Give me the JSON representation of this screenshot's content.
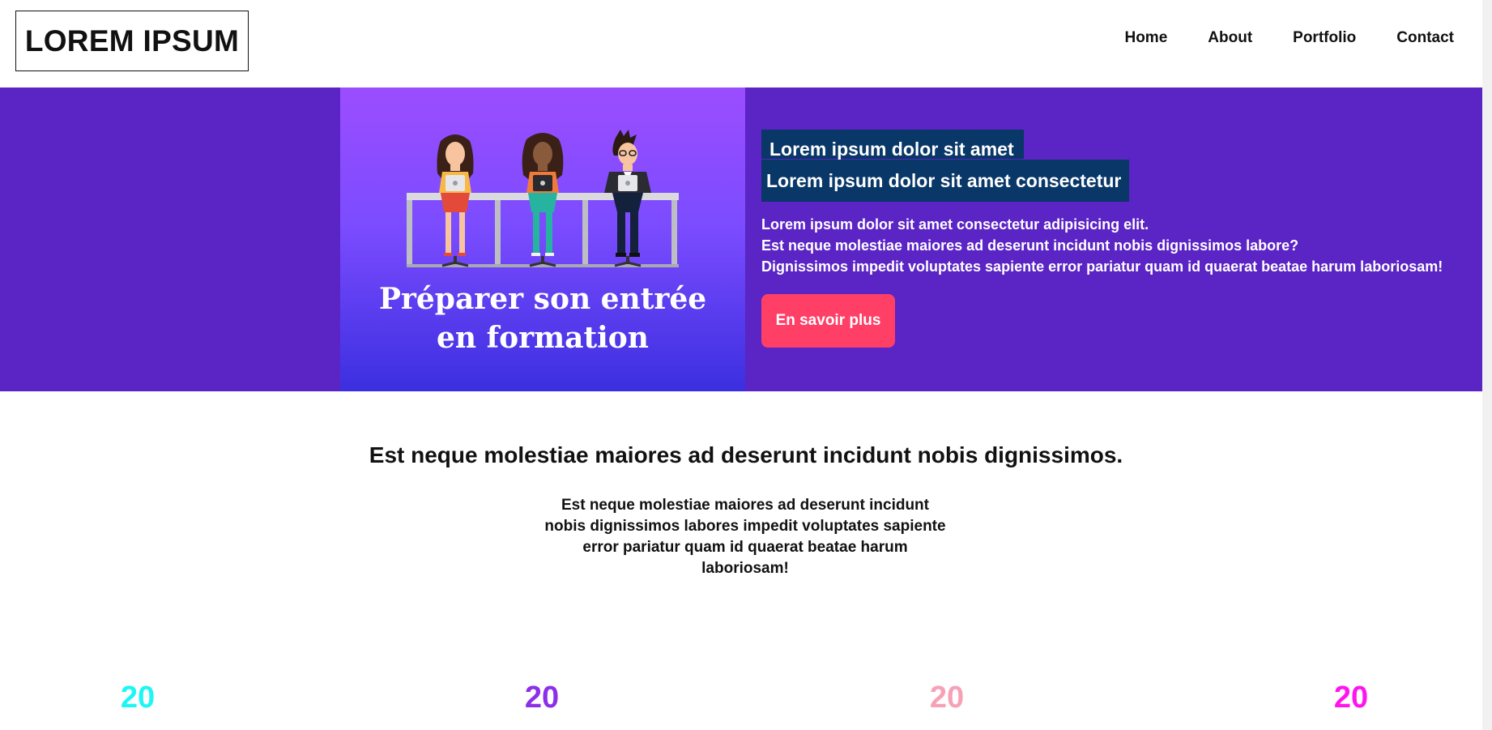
{
  "header": {
    "logo": "LOREM IPSUM",
    "nav": [
      "Home",
      "About",
      "Portfolio",
      "Contact"
    ]
  },
  "hero": {
    "image_caption_line1": "Préparer son entrée",
    "image_caption_line2": "en formation",
    "highlight_line1": "Lorem ipsum dolor sit amet",
    "highlight_line2": "Lorem ipsum dolor sit amet consectetur",
    "paragraph": [
      "Lorem ipsum dolor sit amet consectetur adipisicing elit.",
      "Est neque molestiae maiores ad deserunt incidunt nobis dignissimos labore?",
      "Dignissimos impedit voluptates sapiente error pariatur quam id quaerat beatae harum laboriosam!"
    ],
    "cta_label": "En savoir plus"
  },
  "section": {
    "title": "Est neque molestiae maiores ad deserunt incidunt nobis dignissimos.",
    "text_lines": [
      "Est neque molestiae maiores ad deserunt incidunt",
      "nobis dignissimos labores impedit voluptates sapiente",
      "error pariatur quam id quaerat beatae harum",
      "laboriosam!"
    ]
  },
  "stats": [
    {
      "value": "20",
      "color": "#1ef6f6"
    },
    {
      "value": "20",
      "color": "#8d2ee8"
    },
    {
      "value": "20",
      "color": "#f7a1b5"
    },
    {
      "value": "20",
      "color": "#ff14f0"
    }
  ],
  "colors": {
    "hero_bg": "#5b24c5",
    "highlight_bg": "#083768",
    "cta_bg": "#ff3f66"
  },
  "illustration": {
    "icon": "people-at-desk-with-laptops"
  }
}
